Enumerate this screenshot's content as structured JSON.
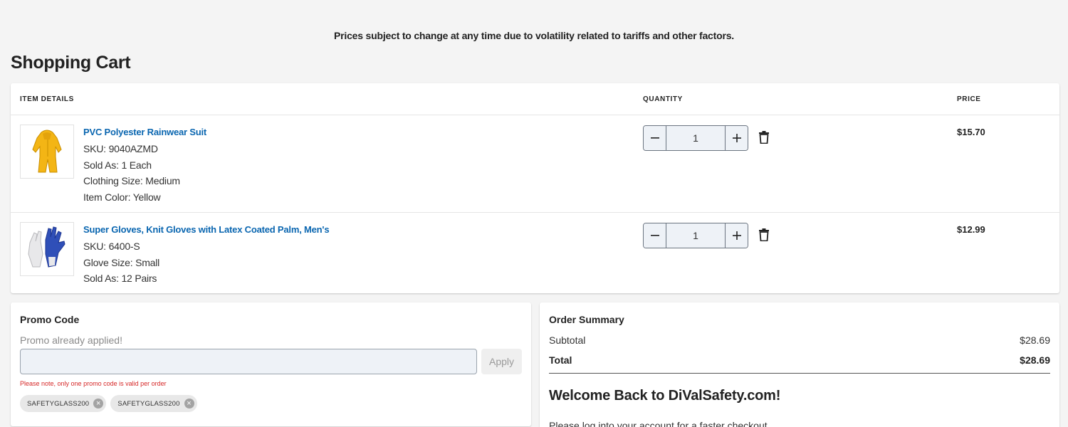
{
  "notice": "Prices subject to change at any time due to volatility related to tariffs and other factors.",
  "page_title": "Shopping Cart",
  "cart": {
    "headers": {
      "item": "ITEM DETAILS",
      "quantity": "QUANTITY",
      "price": "PRICE"
    },
    "items": [
      {
        "name": "PVC Polyester Rainwear Suit",
        "sku": "SKU: 9040AZMD",
        "sold_as": "Sold As: 1 Each",
        "attr1": "Clothing Size: Medium",
        "attr2": "Item Color: Yellow",
        "quantity": "1",
        "price": "$15.70",
        "image_icon": "rainwear-suit-image"
      },
      {
        "name": "Super Gloves, Knit Gloves with Latex Coated Palm, Men's",
        "sku": "SKU: 6400-S",
        "attr1": "Glove Size: Small",
        "sold_as": "Sold As: 12 Pairs",
        "quantity": "1",
        "price": "$12.99",
        "image_icon": "gloves-image"
      }
    ]
  },
  "promo": {
    "title": "Promo Code",
    "status": "Promo already applied!",
    "input_value": "",
    "apply_label": "Apply",
    "note": "Please note, only one promo code is valid per order",
    "codes": [
      "SAFETYGLASS200",
      "SAFETYGLASS200"
    ]
  },
  "summary": {
    "title": "Order Summary",
    "subtotal_label": "Subtotal",
    "subtotal_value": "$28.69",
    "total_label": "Total",
    "total_value": "$28.69",
    "welcome": "Welcome Back to DiValSafety.com!",
    "login_text": "Please log into your account for a faster checkout"
  },
  "colors": {
    "link": "#0a66b0",
    "note": "#d62828",
    "background": "#f4f4f4"
  }
}
